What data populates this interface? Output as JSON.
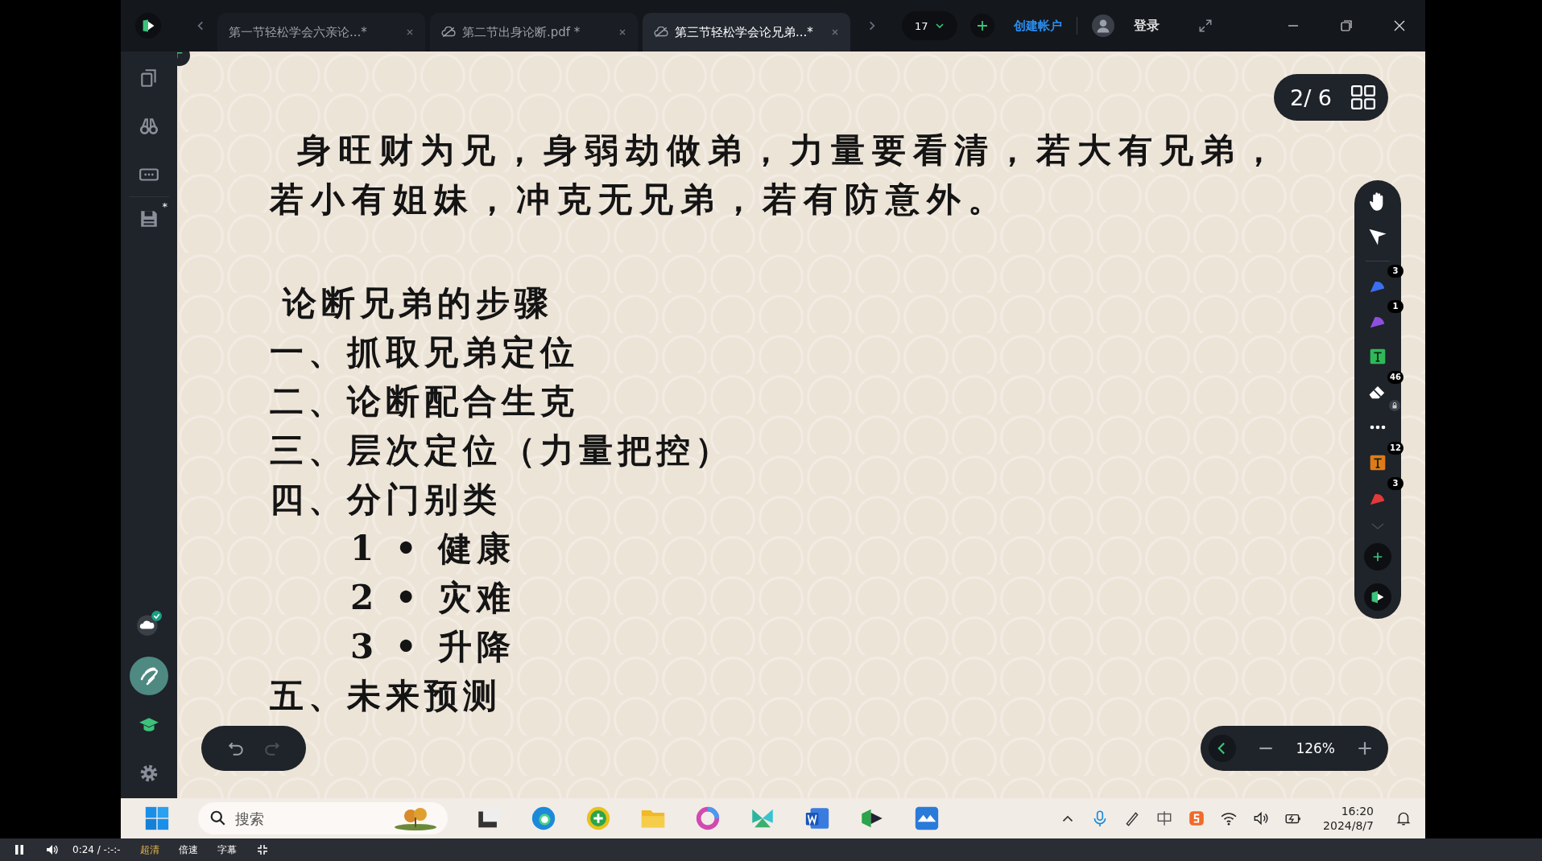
{
  "tabs": [
    {
      "label": "第一节轻松学会六亲论...*",
      "selected": false,
      "cloud": false
    },
    {
      "label": "第二节出身论断.pdf *",
      "selected": false,
      "cloud": true
    },
    {
      "label": "第三节轻松学会论兄弟...*",
      "selected": true,
      "cloud": true
    }
  ],
  "tab_count": "17",
  "account": {
    "create": "创建帐户",
    "login": "登录"
  },
  "sidebar": {
    "save_mark": "*"
  },
  "page_indicator": "2/ 6",
  "document": {
    "paragraph": [
      "身旺财为兄，身弱劫做弟，力量要看清，若大有兄弟，",
      "若小有姐妹，冲克无兄弟，若有防意外。"
    ],
    "heading": "论断兄弟的步骤",
    "steps": [
      {
        "text": "一、抓取兄弟定位"
      },
      {
        "text": "二、论断配合生克"
      },
      {
        "text": "三、层次定位（力量把控）"
      },
      {
        "text": "四、分门别类",
        "children": [
          {
            "text": "1 • 健康"
          },
          {
            "text": "2 • 灾难"
          },
          {
            "text": "3 • 升降"
          }
        ]
      },
      {
        "text": "五、未来预测"
      }
    ]
  },
  "tools": [
    {
      "kind": "pen",
      "color": "#3b6ff0",
      "badge": "3"
    },
    {
      "kind": "pen",
      "color": "#8e4fe0",
      "badge": "1"
    },
    {
      "kind": "text",
      "color": "#2fb85a"
    },
    {
      "kind": "eraser",
      "badge": "46"
    },
    {
      "kind": "text",
      "color": "#e07a18",
      "badge": "12"
    },
    {
      "kind": "pen",
      "color": "#e03a3a",
      "badge": "3"
    }
  ],
  "zoom": "126%",
  "taskbar": {
    "search_placeholder": "搜索",
    "time": "16:20",
    "date": "2024/8/7"
  },
  "player": {
    "playing": true,
    "time": "0:24 / -:-:-",
    "quality": "超清",
    "speed": "倍速",
    "subtitles": "字幕"
  }
}
